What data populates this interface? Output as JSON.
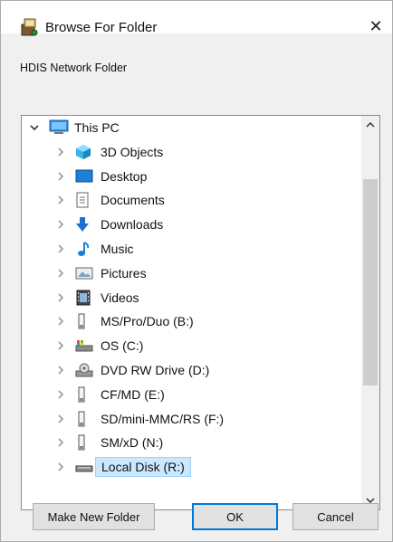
{
  "window": {
    "title": "Browse For Folder",
    "description": "HDIS Network Folder",
    "close_glyph": "✕"
  },
  "tree": {
    "items": [
      {
        "label": "This PC",
        "icon": "computer-icon",
        "expanded": true,
        "level": 0
      },
      {
        "label": "3D Objects",
        "icon": "3d-objects-icon",
        "level": 1
      },
      {
        "label": "Desktop",
        "icon": "desktop-icon",
        "level": 1
      },
      {
        "label": "Documents",
        "icon": "documents-icon",
        "level": 1
      },
      {
        "label": "Downloads",
        "icon": "downloads-icon",
        "level": 1
      },
      {
        "label": "Music",
        "icon": "music-icon",
        "level": 1
      },
      {
        "label": "Pictures",
        "icon": "pictures-icon",
        "level": 1
      },
      {
        "label": "Videos",
        "icon": "videos-icon",
        "level": 1
      },
      {
        "label": "MS/Pro/Duo (B:)",
        "icon": "removable-drive-icon",
        "level": 1
      },
      {
        "label": "OS (C:)",
        "icon": "os-drive-icon",
        "level": 1
      },
      {
        "label": "DVD RW Drive (D:)",
        "icon": "dvd-drive-icon",
        "level": 1
      },
      {
        "label": "CF/MD (E:)",
        "icon": "removable-drive-icon",
        "level": 1
      },
      {
        "label": "SD/mini-MMC/RS (F:)",
        "icon": "removable-drive-icon",
        "level": 1
      },
      {
        "label": "SM/xD (N:)",
        "icon": "removable-drive-icon",
        "level": 1
      },
      {
        "label": "Local Disk (R:)",
        "icon": "local-disk-icon",
        "level": 1,
        "selected": true
      }
    ]
  },
  "buttons": {
    "make_new_folder": "Make New Folder",
    "ok": "OK",
    "cancel": "Cancel"
  },
  "colors": {
    "accent": "#0078d7",
    "selection": "#cce8ff",
    "folder_blue": "#1e90d6",
    "download_blue": "#1f6fd1"
  }
}
